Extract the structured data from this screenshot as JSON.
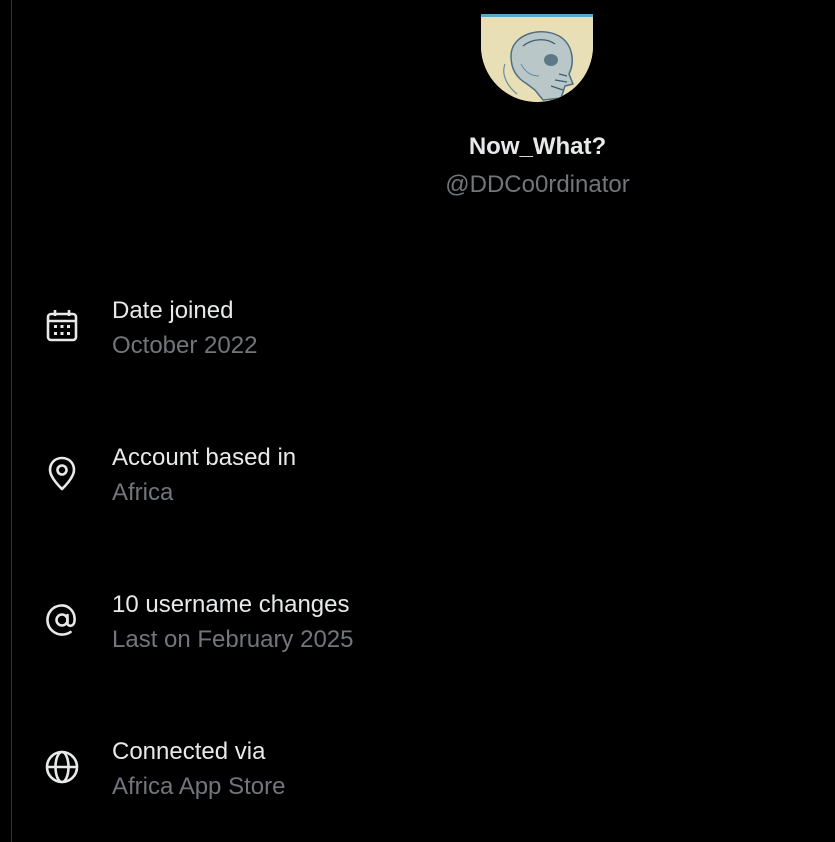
{
  "profile": {
    "display_name": "Now_What?",
    "handle": "@DDCo0rdinator"
  },
  "about": {
    "items": [
      {
        "icon": "calendar-icon",
        "title": "Date joined",
        "value": "October 2022"
      },
      {
        "icon": "location-pin-icon",
        "title": "Account based in",
        "value": "Africa"
      },
      {
        "icon": "at-sign-icon",
        "title": "10 username changes",
        "value": "Last on February 2025"
      },
      {
        "icon": "globe-icon",
        "title": "Connected via",
        "value": "Africa App Store"
      }
    ]
  },
  "colors": {
    "background": "#000000",
    "primary_text": "#e7e9ea",
    "secondary_text": "#71767b"
  }
}
